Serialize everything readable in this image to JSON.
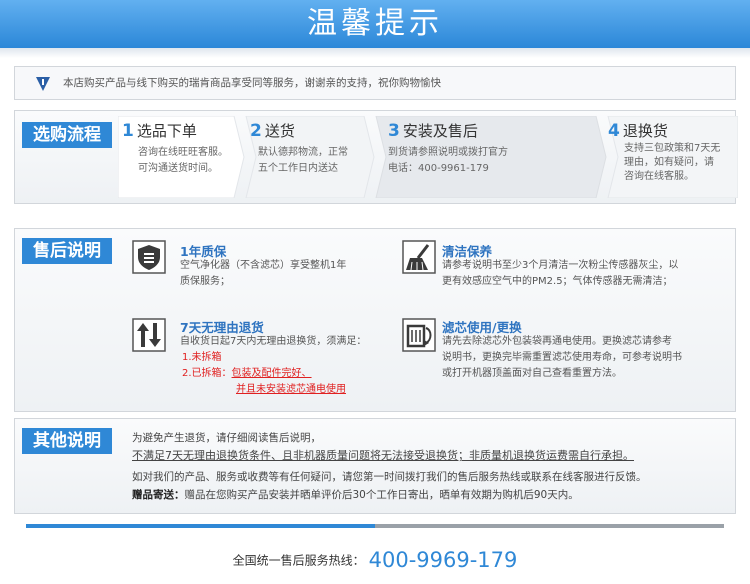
{
  "banner": {
    "title": "温馨提示"
  },
  "notice": {
    "icon": "down-triangle-icon",
    "text": "本店购买产品与线下购买的瑞肯商品享受同等服务，谢谢亲的支持，祝你购物愉快"
  },
  "purchase": {
    "tag": "选购流程",
    "steps": [
      {
        "num": "1",
        "title": "选品下单",
        "lines": [
          "咨询在线旺旺客服。",
          "可沟通送货时间。"
        ]
      },
      {
        "num": "2",
        "title": "送货",
        "lines": [
          "默认德邦物流，正常",
          "五个工作日内送达"
        ]
      },
      {
        "num": "3",
        "title": "安装及售后",
        "lines": [
          "到货请参照说明或拨打官方",
          "电话：400-9961-179"
        ]
      },
      {
        "num": "4",
        "title": "退换货",
        "lines": [
          "支持三包政策和7天无",
          "理由，如有疑问，请",
          "咨询在线客服。"
        ]
      }
    ]
  },
  "after_sales": {
    "tag": "售后说明",
    "warranty": {
      "icon": "shield-icon",
      "title": "1年质保",
      "lines": [
        "空气净化器（不含滤芯）享受整机1年",
        "质保服务；"
      ]
    },
    "cleaning": {
      "icon": "broom-icon",
      "title": "清洁保养",
      "lines": [
        "请参考说明书至少3个月清洁一次粉尘传感器灰尘，以",
        "更有效感应空气中的PM2.5；气体传感器无需清洁；"
      ]
    },
    "returns": {
      "icon": "return-arrows-icon",
      "title": "7天无理由退货",
      "lines": [
        "自收货日起7天内无理由退换货，须满足："
      ],
      "cond1": "1.未拆箱",
      "cond2": "2.已拆箱：",
      "cond2_a": "包装及配件完好、",
      "cond2_b": "并且未安装滤芯通电使用"
    },
    "filter": {
      "icon": "filter-replace-icon",
      "title": "滤芯使用/更换",
      "lines": [
        "请先去除滤芯外包装袋再通电使用。更换滤芯请参考",
        "说明书，更换完毕需重置滤芯使用寿命，可参考说明书",
        "或打开机器顶盖面对自己查看重置方法。"
      ]
    }
  },
  "other": {
    "tag": "其他说明",
    "line1": "为避免产生退货，请仔细阅读售后说明，",
    "line2": "不满足7天无理由退换货条件、且非机器质量问题将无法接受退换货；非质量机退换货运费需自行承担。",
    "line3": "如对我们的产品、服务或收费等有任何疑问，请您第一时间拨打我们的售后服务热线或联系在线客服进行反馈。",
    "gift_label": "赠品寄送：",
    "gift_text": "赠品在您购买产品安装并晒单评价后30个工作日寄出，晒单有效期为购机后90天内。"
  },
  "progress": {
    "fraction": 0.5
  },
  "footer": {
    "label": "全国统一售后服务热线：",
    "phone": "400-9969-179"
  },
  "colors": {
    "accent": "#2f88d6",
    "warning": "#e02020"
  }
}
